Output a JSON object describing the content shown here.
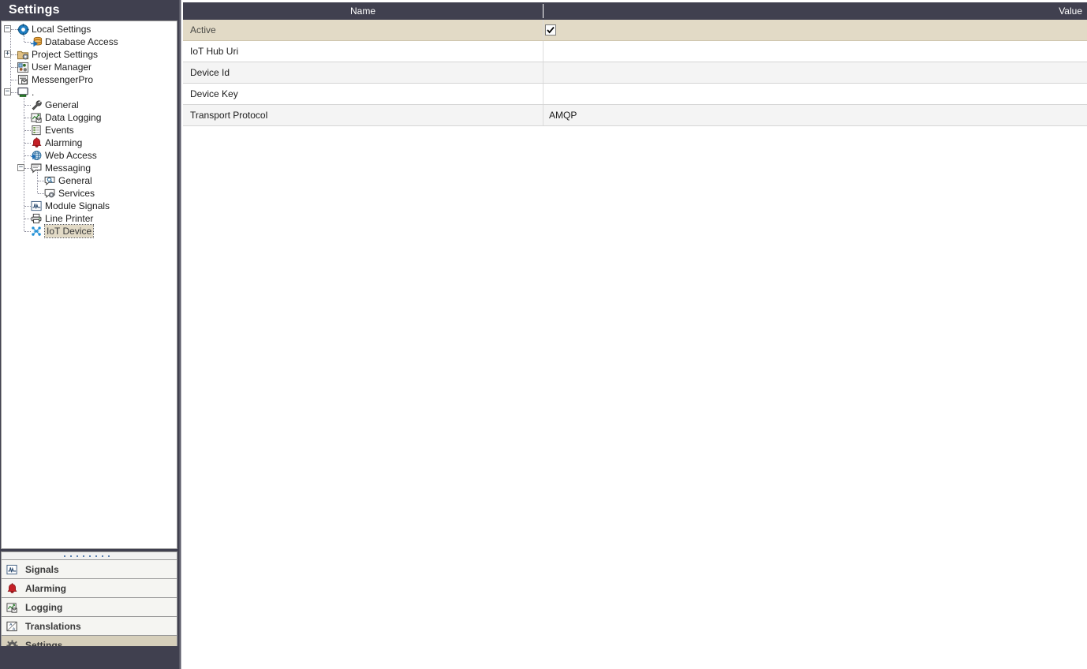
{
  "window": {
    "title": "Settings"
  },
  "tree": {
    "nodes": [
      {
        "label": "Local Settings",
        "icon": "gear-blue-icon",
        "depth": 0,
        "expander": "minus"
      },
      {
        "label": "Database Access",
        "icon": "database-arrow-icon",
        "depth": 1,
        "expander": "none"
      },
      {
        "label": "Project Settings",
        "icon": "project-folder-icon",
        "depth": 0,
        "expander": "plus"
      },
      {
        "label": "User Manager",
        "icon": "user-manager-icon",
        "depth": 0,
        "expander": "none"
      },
      {
        "label": "MessengerPro",
        "icon": "messenger-pro-icon",
        "depth": 0,
        "expander": "none"
      },
      {
        "label": ".",
        "icon": "computer-icon",
        "depth": 0,
        "expander": "minus"
      },
      {
        "label": "General",
        "icon": "wrench-icon",
        "depth": 1,
        "expander": "none"
      },
      {
        "label": "Data Logging",
        "icon": "data-logging-icon",
        "depth": 1,
        "expander": "none"
      },
      {
        "label": "Events",
        "icon": "events-list-icon",
        "depth": 1,
        "expander": "none"
      },
      {
        "label": "Alarming",
        "icon": "bell-red-icon",
        "depth": 1,
        "expander": "none"
      },
      {
        "label": "Web Access",
        "icon": "globe-icon",
        "depth": 1,
        "expander": "none"
      },
      {
        "label": "Messaging",
        "icon": "speech-bubble-icon",
        "depth": 1,
        "expander": "minus"
      },
      {
        "label": "General",
        "icon": "message-general-icon",
        "depth": 2,
        "expander": "none"
      },
      {
        "label": "Services",
        "icon": "message-services-icon",
        "depth": 2,
        "expander": "none"
      },
      {
        "label": "Module Signals",
        "icon": "signal-wave-icon",
        "depth": 1,
        "expander": "none"
      },
      {
        "label": "Line Printer",
        "icon": "printer-icon",
        "depth": 1,
        "expander": "none"
      },
      {
        "label": "IoT Device",
        "icon": "iot-molecule-icon",
        "depth": 1,
        "expander": "none",
        "selected": true
      }
    ]
  },
  "bottom_nav": {
    "items": [
      {
        "label": "Signals",
        "icon": "signal-wave-icon",
        "selected": false
      },
      {
        "label": "Alarming",
        "icon": "bell-red-icon",
        "selected": false
      },
      {
        "label": "Logging",
        "icon": "data-logging-icon",
        "selected": false
      },
      {
        "label": "Translations",
        "icon": "translations-icon",
        "selected": false
      },
      {
        "label": "Settings",
        "icon": "gear-icon",
        "selected": true
      }
    ]
  },
  "table": {
    "columns": [
      {
        "key": "name",
        "label": "Name"
      },
      {
        "key": "value",
        "label": "Value"
      }
    ],
    "rows": [
      {
        "name": "Active",
        "value": "",
        "type": "checkbox",
        "checked": true,
        "selected": true
      },
      {
        "name": "IoT Hub Uri",
        "value": "",
        "type": "text",
        "selected": false
      },
      {
        "name": "Device Id",
        "value": "",
        "type": "text",
        "selected": false
      },
      {
        "name": "Device Key",
        "value": "",
        "type": "text",
        "selected": false
      },
      {
        "name": "Transport Protocol",
        "value": "AMQP",
        "type": "text",
        "selected": false
      }
    ]
  },
  "colors": {
    "chrome_dark": "#40404f",
    "selection_tan": "#e2dac6",
    "nav_selected": "#d6cfbb",
    "row_alt": "#f4f4f4",
    "alarm_red": "#c42026",
    "accent_blue": "#1f6fb5"
  }
}
